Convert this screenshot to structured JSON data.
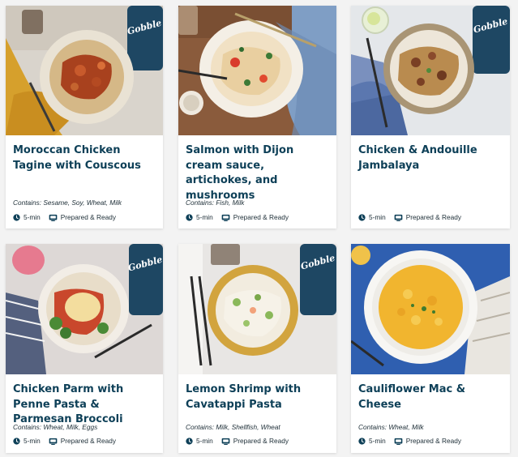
{
  "meals": [
    {
      "title": "Moroccan Chicken Tagine with Couscous",
      "contains": "Contains: Sesame, Soy, Wheat, Milk",
      "time": "5-min",
      "prep": "Prepared & Ready",
      "photo_alt": "Moroccan chicken tagine served over couscous"
    },
    {
      "title": "Salmon with Dijon cream sauce, artichokes, and mushrooms",
      "contains": "Contains: Fish, Milk",
      "time": "5-min",
      "prep": "Prepared & Ready",
      "photo_alt": "Salmon with dijon cream sauce plated on a white dish"
    },
    {
      "title": "Chicken & Andouille Jambalaya",
      "contains": "",
      "time": "5-min",
      "prep": "Prepared & Ready",
      "photo_alt": "Chicken and andouille jambalaya in a bowl"
    },
    {
      "title": "Chicken Parm with Penne Pasta & Parmesan Broccoli",
      "contains": "Contains: Wheat, Milk, Eggs",
      "time": "5-min",
      "prep": "Prepared & Ready",
      "photo_alt": "Chicken parmesan with penne and broccoli"
    },
    {
      "title": "Lemon Shrimp with Cavatappi Pasta",
      "contains": "Contains: Milk, Shellfish, Wheat",
      "time": "5-min",
      "prep": "Prepared & Ready",
      "photo_alt": "Lemon shrimp with cavatappi pasta in a yellow bowl"
    },
    {
      "title": "Cauliflower Mac & Cheese",
      "contains": "Contains: Wheat, Milk",
      "time": "5-min",
      "prep": "Prepared & Ready",
      "photo_alt": "Cauliflower mac and cheese topped with herbs"
    }
  ],
  "brand": {
    "logo_text": "Gobble",
    "accent": "#0e4058"
  },
  "icons": {
    "time": "clock-icon",
    "prep": "meal-box-icon"
  }
}
